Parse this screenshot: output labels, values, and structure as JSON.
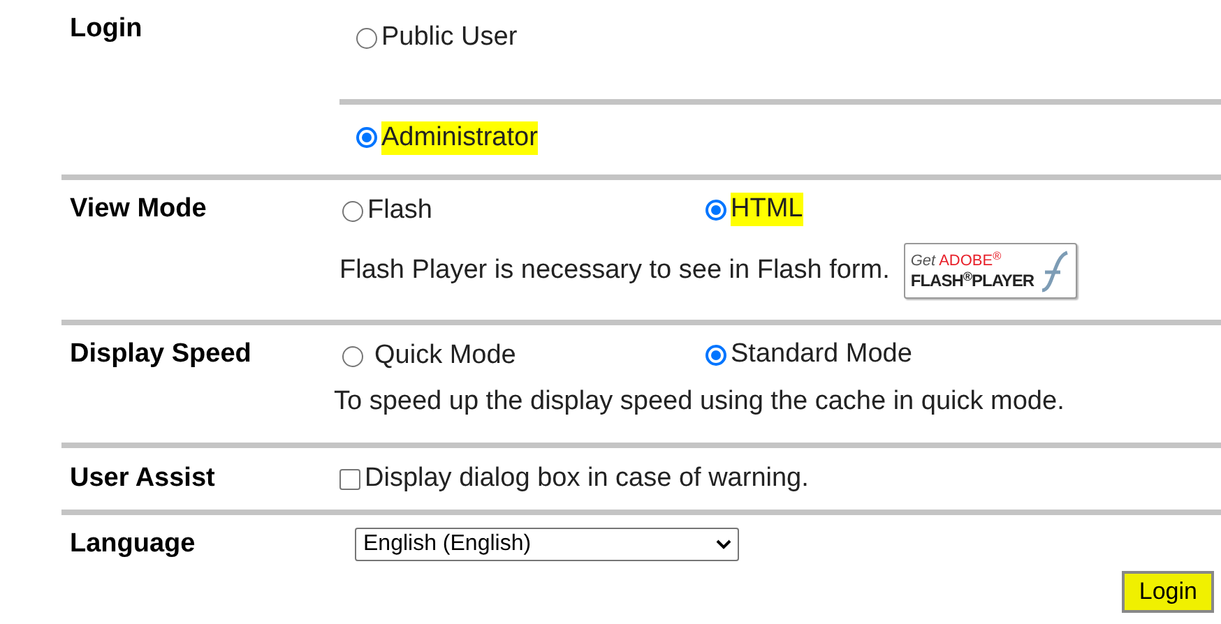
{
  "rows": [
    {
      "kind": "radio-stack",
      "label": "Login",
      "options": [
        {
          "label": "Public User",
          "selected": false,
          "highlighted": false
        },
        {
          "label": "Administrator",
          "selected": true,
          "highlighted": true
        }
      ]
    },
    {
      "kind": "radio-pair",
      "label": "View Mode",
      "options": [
        {
          "label": "Flash",
          "selected": false,
          "highlighted": false
        },
        {
          "label": "HTML",
          "selected": true,
          "highlighted": true
        }
      ],
      "note": "Flash Player is necessary to see in Flash form.",
      "badge": {
        "prefix": "Get",
        "brand": "ADOBE$^{®}$",
        "product": "FLASH$^{®}$PLAYER"
      }
    },
    {
      "kind": "radio-pair",
      "label": "Display Speed",
      "options": [
        {
          "label": "Quick Mode",
          "selected": false,
          "highlighted": false
        },
        {
          "label": "Standard Mode",
          "selected": true,
          "highlighted": false
        }
      ],
      "note": "To speed up the display speed using the cache in quick mode."
    },
    {
      "kind": "checkbox",
      "label": "User Assist",
      "checked": false,
      "text": "Display dialog box in case of warning."
    },
    {
      "kind": "select",
      "label": "Language",
      "value": "English (English)"
    }
  ],
  "login_button": {
    "label": "Login",
    "highlighted": true
  }
}
